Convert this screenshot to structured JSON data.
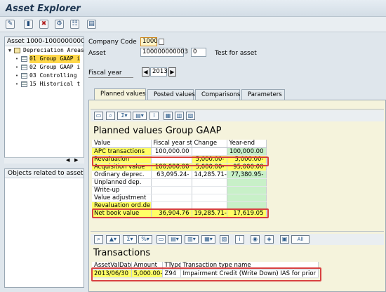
{
  "window": {
    "title": "Asset Explorer"
  },
  "toolbar": {
    "icons": [
      "display-change-icon",
      "asset-master-icon",
      "delete-icon",
      "settings-icon",
      "network-icon",
      "list-icon"
    ]
  },
  "tree": {
    "header": "Asset 1000-1000000000...",
    "root": "Depreciation Areas",
    "items": [
      "01 Group GAAP i",
      "02 Group GAAP i",
      "03 Controlling",
      "15 Historical t"
    ]
  },
  "objects_panel": {
    "title": "Objects related to asset"
  },
  "header_fields": {
    "company_code_label": "Company Code",
    "company_code": "1000",
    "asset_label": "Asset",
    "asset": "100000000003",
    "subnumber": "0",
    "asset_text": "Test for asset",
    "fiscal_year_label": "Fiscal year",
    "fiscal_year": "2013"
  },
  "tabs": [
    "Planned values",
    "Posted values",
    "Comparisons",
    "Parameters"
  ],
  "planned": {
    "title": "Planned values Group GAAP",
    "columns": [
      "Value",
      "Fiscal year start",
      "Change",
      "Year-end"
    ],
    "rows": [
      {
        "label": "APC transactions",
        "start": "100,000.00",
        "change": "",
        "end": "100,000.00"
      },
      {
        "label": "Revaluation",
        "start": "",
        "change": "5,000.00-",
        "end": "5,000.00-"
      },
      {
        "label": "Acquisition value",
        "start": "100,000.00",
        "change": "5,000.00-",
        "end": "95,000.00"
      },
      {
        "label": "Ordinary deprec.",
        "start": "63,095.24-",
        "change": "14,285.71-",
        "end": "77,380.95-"
      },
      {
        "label": "Unplanned dep.",
        "start": "",
        "change": "",
        "end": ""
      },
      {
        "label": "Write-up",
        "start": "",
        "change": "",
        "end": ""
      },
      {
        "label": "Value adjustment",
        "start": "",
        "change": "",
        "end": ""
      },
      {
        "label": "Revaluation ord.dep.",
        "start": "",
        "change": "",
        "end": ""
      },
      {
        "label": "Net book value",
        "start": "36,904.76",
        "change": "19,285.71-",
        "end": "17,619.05"
      }
    ]
  },
  "transactions": {
    "title": "Transactions",
    "columns": [
      "AssetValDate",
      "Amount",
      "TType",
      "Transaction type name"
    ],
    "rows": [
      {
        "date": "2013/06/30",
        "amount": "5,000.00-",
        "ttype": "Z94",
        "name": "Impairment Credit (Write Down) IAS for prior year"
      }
    ],
    "all_label": "All"
  }
}
